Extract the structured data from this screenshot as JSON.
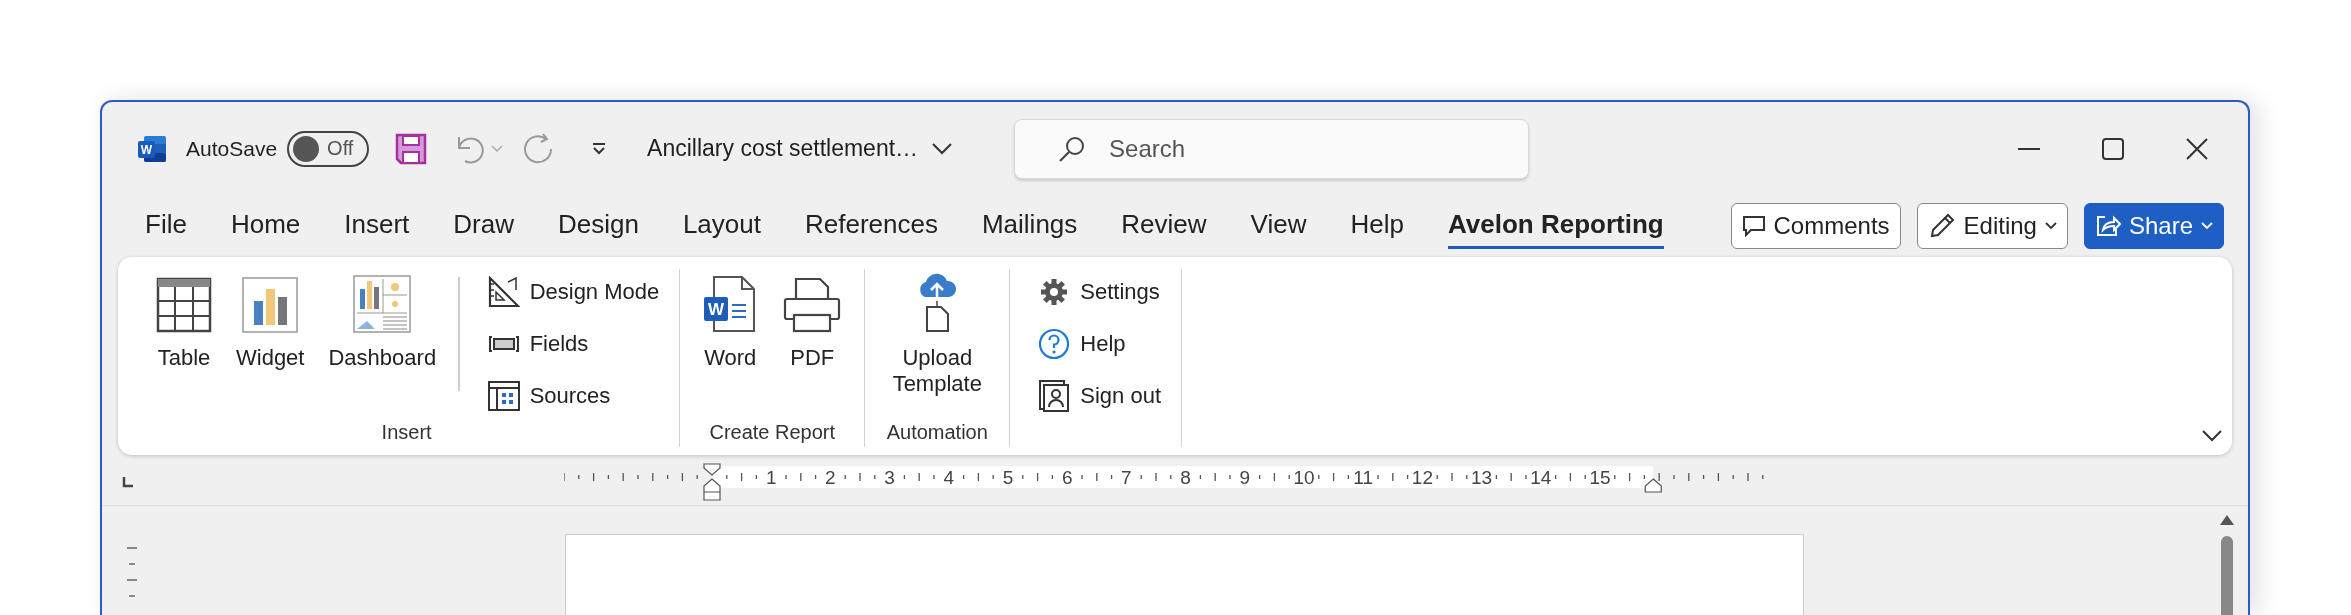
{
  "title_bar": {
    "app_icon_letter": "W",
    "autosave_label": "AutoSave",
    "autosave_toggle": {
      "label": "Off",
      "on": false
    },
    "document_title": "Ancillary cost settlement…",
    "search": {
      "placeholder": "Search"
    }
  },
  "ribbon_tabs": [
    {
      "label": "File",
      "selected": false
    },
    {
      "label": "Home",
      "selected": false
    },
    {
      "label": "Insert",
      "selected": false
    },
    {
      "label": "Draw",
      "selected": false
    },
    {
      "label": "Design",
      "selected": false
    },
    {
      "label": "Layout",
      "selected": false
    },
    {
      "label": "References",
      "selected": false
    },
    {
      "label": "Mailings",
      "selected": false
    },
    {
      "label": "Review",
      "selected": false
    },
    {
      "label": "View",
      "selected": false
    },
    {
      "label": "Help",
      "selected": false
    },
    {
      "label": "Avelon Reporting",
      "selected": true
    }
  ],
  "header_buttons": [
    {
      "kind": "comments",
      "label": "Comments"
    },
    {
      "kind": "editing",
      "label": "Editing"
    },
    {
      "kind": "share",
      "label": "Share"
    }
  ],
  "ribbon_groups": [
    {
      "label": "Insert",
      "large_items": [
        {
          "kind": "table",
          "label": "Table"
        },
        {
          "kind": "widget",
          "label": "Widget"
        },
        {
          "kind": "dashboard",
          "label": "Dashboard"
        }
      ],
      "small_items": [
        {
          "kind": "design_mode",
          "label": "Design Mode"
        },
        {
          "kind": "fields",
          "label": "Fields"
        },
        {
          "kind": "sources",
          "label": "Sources"
        }
      ]
    },
    {
      "label": "Create Report",
      "large_items": [
        {
          "kind": "word",
          "label": "Word",
          "icon_letter": "W"
        },
        {
          "kind": "pdf",
          "label": "PDF"
        }
      ]
    },
    {
      "label": "Automation",
      "large_items": [
        {
          "kind": "upload",
          "label": "Upload Template"
        }
      ]
    },
    {
      "small_items": [
        {
          "kind": "settings",
          "label": "Settings"
        },
        {
          "kind": "help",
          "label": "Help"
        },
        {
          "kind": "sign_out",
          "label": "Sign out"
        }
      ]
    }
  ],
  "ruler": {
    "numbers": [
      "1",
      "2",
      "3",
      "4",
      "5",
      "6",
      "7",
      "8",
      "9",
      "10",
      "11",
      "12",
      "13",
      "14",
      "15"
    ]
  }
}
